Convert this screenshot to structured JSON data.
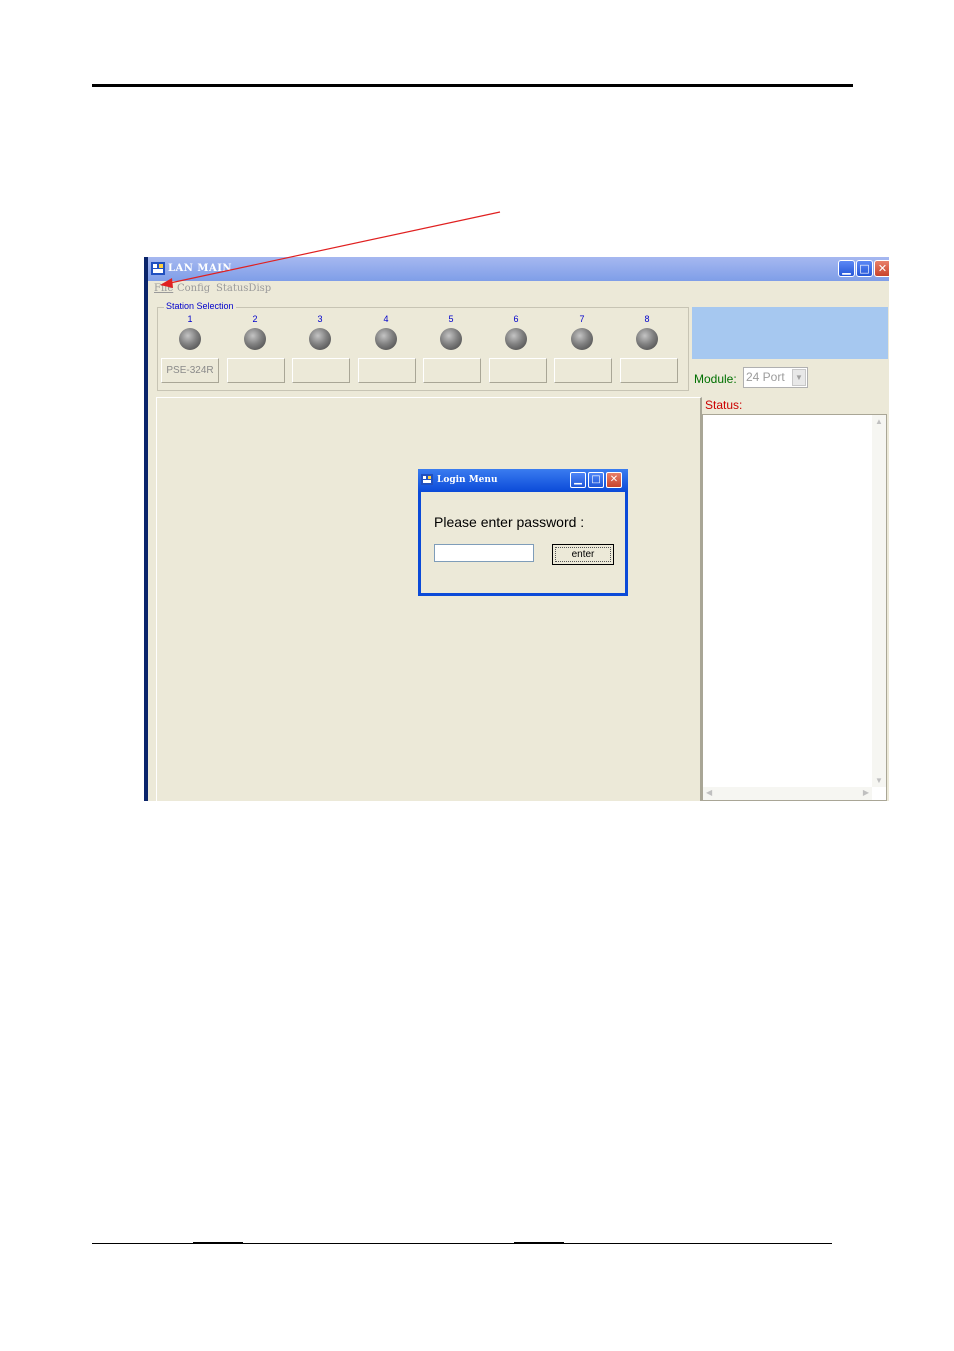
{
  "window": {
    "title": "LAN MAIN",
    "menu": [
      {
        "label": "File"
      },
      {
        "label": "Config"
      },
      {
        "label": "StatusDisp"
      }
    ]
  },
  "station_selection": {
    "label": "Station Selection",
    "stations": [
      {
        "number": "1",
        "button_label": "PSE-324R"
      },
      {
        "number": "2",
        "button_label": ""
      },
      {
        "number": "3",
        "button_label": ""
      },
      {
        "number": "4",
        "button_label": ""
      },
      {
        "number": "5",
        "button_label": ""
      },
      {
        "number": "6",
        "button_label": ""
      },
      {
        "number": "7",
        "button_label": ""
      },
      {
        "number": "8",
        "button_label": ""
      }
    ]
  },
  "module": {
    "label": "Module:",
    "selected": "24 Port"
  },
  "status": {
    "label": "Status:"
  },
  "login_dialog": {
    "title": "Login Menu",
    "prompt": "Please enter password :",
    "password_value": "",
    "enter_label": "enter"
  },
  "colors": {
    "annotation_arrow": "#e02020",
    "titlebar": "#7f9ee8",
    "dialog_border": "#0b4ad8"
  }
}
